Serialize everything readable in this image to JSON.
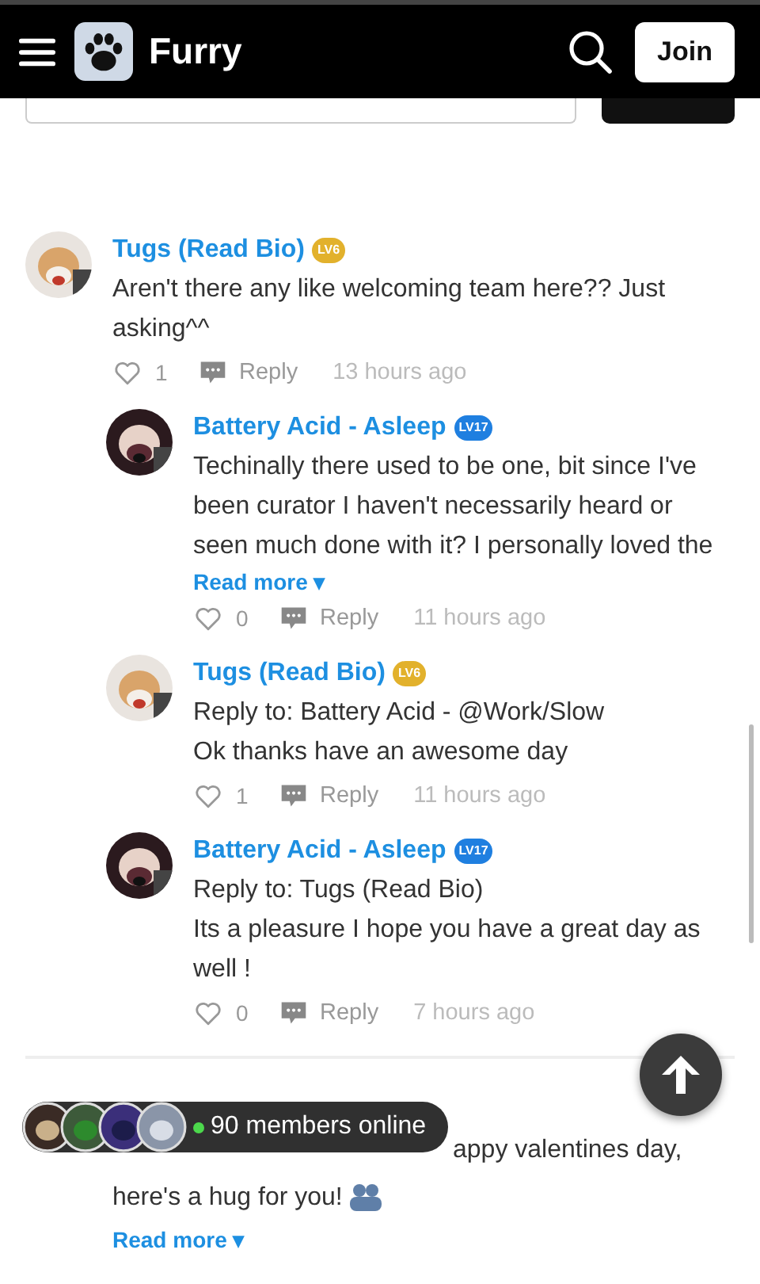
{
  "header": {
    "title": "Furry",
    "join": "Join"
  },
  "composer": {
    "visible": true
  },
  "comments": [
    {
      "kind": "full",
      "name": "Tugs (Read Bio)",
      "badge": {
        "label": "LV6",
        "color": "#e2b12c"
      },
      "text": "Aren't there any like welcoming team here?? Just asking^^",
      "likes": "1",
      "reply": "Reply",
      "time": "13 hours ago",
      "children": [
        {
          "name": "Battery Acid - Asleep",
          "badge": {
            "label": "LV17",
            "color": "#1f7fe0"
          },
          "text": "Techinally there used to be one, bit since I've been curator I haven't necessarily heard or",
          "faded_text": "seen much done with it? I personally loved the",
          "read_more": "Read more ▾",
          "likes": "0",
          "reply": "Reply",
          "time": "11 hours ago"
        },
        {
          "name": "Tugs (Read Bio)",
          "badge": {
            "label": "LV6",
            "color": "#e2b12c"
          },
          "reply_to": "Reply to: Battery Acid - @Work/Slow",
          "text": "Ok thanks have an awesome day",
          "likes": "1",
          "reply": "Reply",
          "time": "11 hours ago"
        },
        {
          "name": "Battery Acid - Asleep",
          "badge": {
            "label": "LV17",
            "color": "#1f7fe0"
          },
          "reply_to": "Reply to: Tugs (Read Bio)",
          "text": "Its a pleasure I hope you have a great day as well !",
          "likes": "0",
          "reply": "Reply",
          "time": "7 hours ago"
        }
      ]
    },
    {
      "kind": "partial",
      "lines": [
        "appy valentines day,",
        "here's a hug for you!"
      ],
      "read_more": "Read more ▾"
    }
  ],
  "online": {
    "text": "90 members online"
  }
}
